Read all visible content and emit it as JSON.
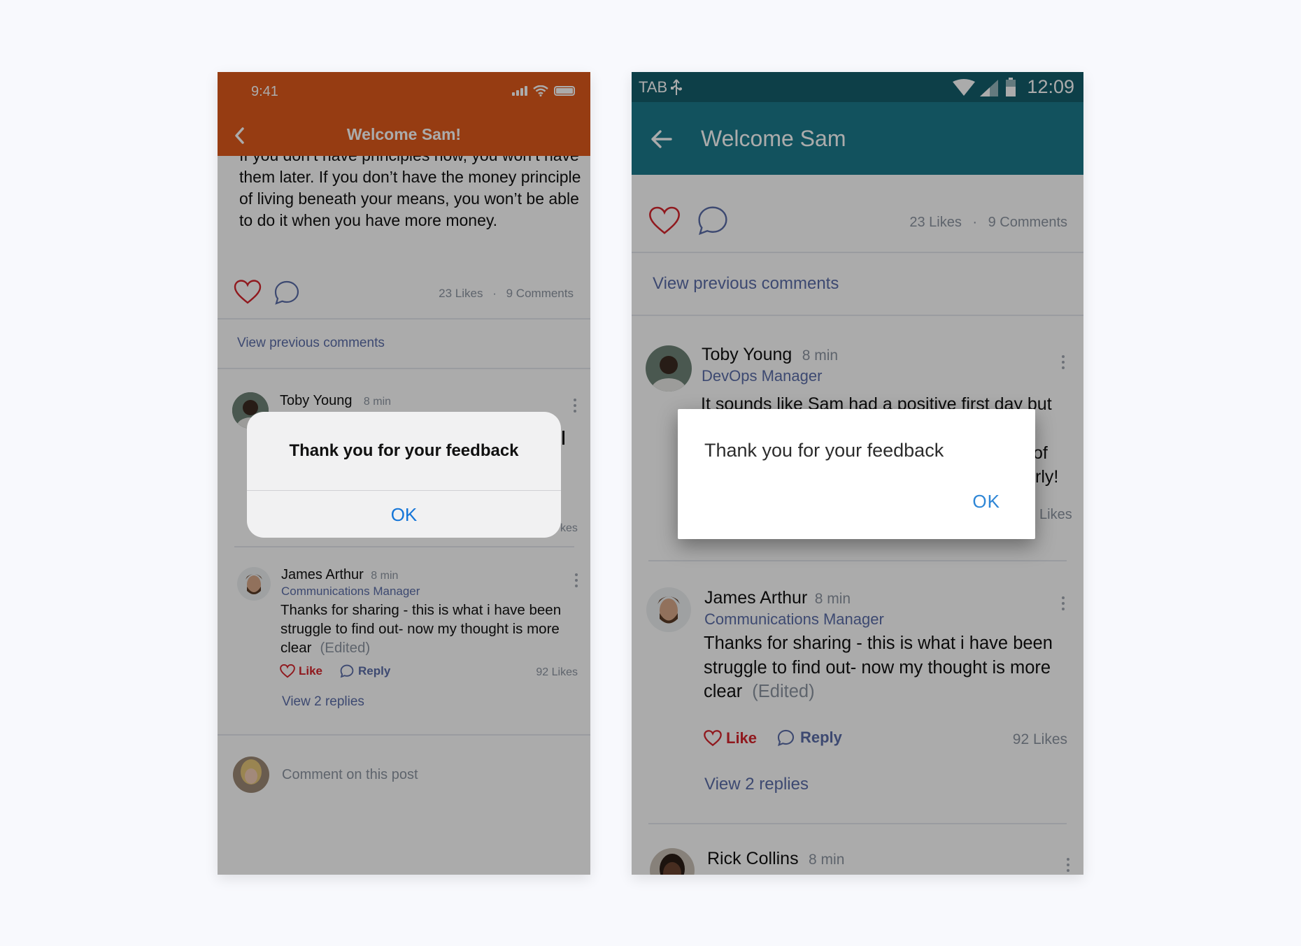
{
  "colors": {
    "ios_header": "#e05a1c",
    "android_status": "#145e6c",
    "android_appbar": "#1b7b8c",
    "like_red": "#d7262e",
    "link_blue": "#5b6ea9",
    "ok_blue": "#1475d8"
  },
  "ios": {
    "status_time": "9:41",
    "header_title": "Welcome Sam!",
    "post_text_lines": [
      "If you don’t have principles now, you won’t have",
      "them later. If you don’t have the money principle",
      "of living beneath your means, you won’t be able",
      "to do it when you have more money."
    ],
    "likes": "23 Likes",
    "dot": "·",
    "comments": "9 Comments",
    "view_previous": "View previous comments",
    "comment1": {
      "name": "Toby Young",
      "time": "8 min",
      "likes_fragment": "kes"
    },
    "comment2": {
      "name": "James Arthur",
      "time": "8 min",
      "role": "Communications Manager",
      "text_lines": [
        "Thanks for sharing - this is what i have been",
        "struggle to find out- now my thought is more",
        "clear"
      ],
      "edited": "(Edited)",
      "like_label": "Like",
      "reply_label": "Reply",
      "likes": "92 Likes",
      "view_replies": "View 2 replies"
    },
    "comment_placeholder": "Comment on this post",
    "alert": {
      "message": "Thank you for your feedback",
      "ok": "OK"
    }
  },
  "android": {
    "status_tab": "TAB",
    "status_time": "12:09",
    "header_title": "Welcome Sam",
    "likes": "23 Likes",
    "dot": "·",
    "comments": "9 Comments",
    "view_previous": "View previous comments",
    "comment1": {
      "name": "Toby Young",
      "time": "8 min",
      "role": "DevOps Manager",
      "text_line1": "It sounds like Sam had a positive first day but",
      "text_frag2": "of",
      "text_frag3": "rly!",
      "likes_fragment": "Likes"
    },
    "comment2": {
      "name": "James Arthur",
      "time": "8 min",
      "role": "Communications Manager",
      "text_lines": [
        "Thanks for sharing - this is what i have been",
        "struggle to find out- now my thought is more",
        "clear"
      ],
      "edited": "(Edited)",
      "like_label": "Like",
      "reply_label": "Reply",
      "likes": "92 Likes",
      "view_replies": "View 2 replies"
    },
    "comment3": {
      "name": "Rick Collins",
      "time": "8 min"
    },
    "dialog": {
      "message": "Thank you for your feedback",
      "ok": "OK"
    }
  },
  "icons": [
    "back-chevron-icon",
    "signal-icon",
    "wifi-icon",
    "battery-icon",
    "heart-icon",
    "comment-bubble-icon",
    "more-dots-icon",
    "back-arrow-icon",
    "usb-icon",
    "sim-signal-icon"
  ]
}
